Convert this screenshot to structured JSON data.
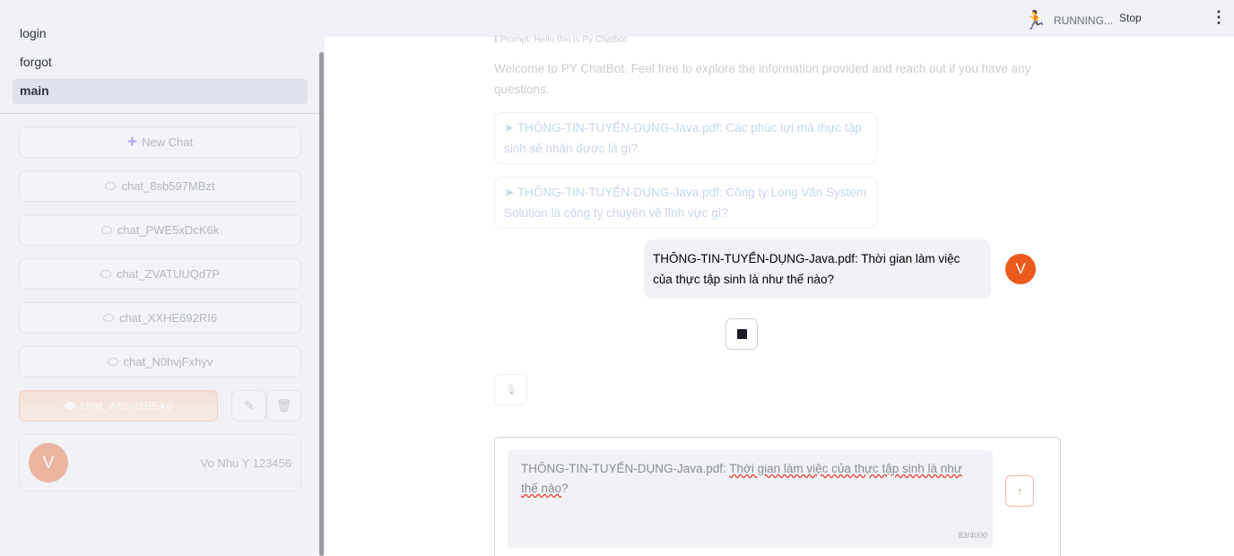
{
  "sidebar": {
    "nav": [
      {
        "label": "login"
      },
      {
        "label": "forgot"
      },
      {
        "label": "main"
      }
    ],
    "new_chat_label": "New Chat",
    "chats": [
      {
        "label": "chat_8sb597MBzt"
      },
      {
        "label": "chat_PWE5xDcK6k"
      },
      {
        "label": "chat_ZVATUUQd7P"
      },
      {
        "label": "chat_XXHE692RI6"
      },
      {
        "label": "chat_N0hvjFxhyv"
      }
    ],
    "active_chat": "chat_A6Sri3B5Xg",
    "user": {
      "initial": "V",
      "name": "Vo Nhu Y 123456"
    }
  },
  "topbar": {
    "status": "RUNNING...",
    "stop_label": "Stop"
  },
  "main": {
    "prompt_hint": "Prompt: Hello this is Py Chatbot",
    "welcome": "Welcome to PY ChatBot. Feel free to explore the information provided and reach out if you have any questions.",
    "suggestions": [
      {
        "text": "➤ THÔNG-TIN-TUYỂN-DỤNG-Java.pdf: Các phúc lợi mà thực tập sinh sẽ nhận được là gì?"
      },
      {
        "text": "➤ THÔNG-TIN-TUYỂN-DỤNG-Java.pdf: Công ty Long Vân System Solution là công ty chuyên về lĩnh vực gì?"
      }
    ],
    "user_message": "THÔNG-TIN-TUYỂN-DỤNG-Java.pdf: Thời gian làm việc của thực tập sinh là như thế nào?",
    "user_avatar": "V",
    "input": {
      "value_plain": "THÔNG-TIN-TUYỂN-DỤNG-Java.pdf: ",
      "value_underlined": "Thời gian làm việc của thực tập sinh là như thế nào",
      "value_tail": "?",
      "counter": "83/4000"
    }
  },
  "colors": {
    "accent": "#ec5a1d",
    "sidebar_bg": "#f0f2f6"
  }
}
